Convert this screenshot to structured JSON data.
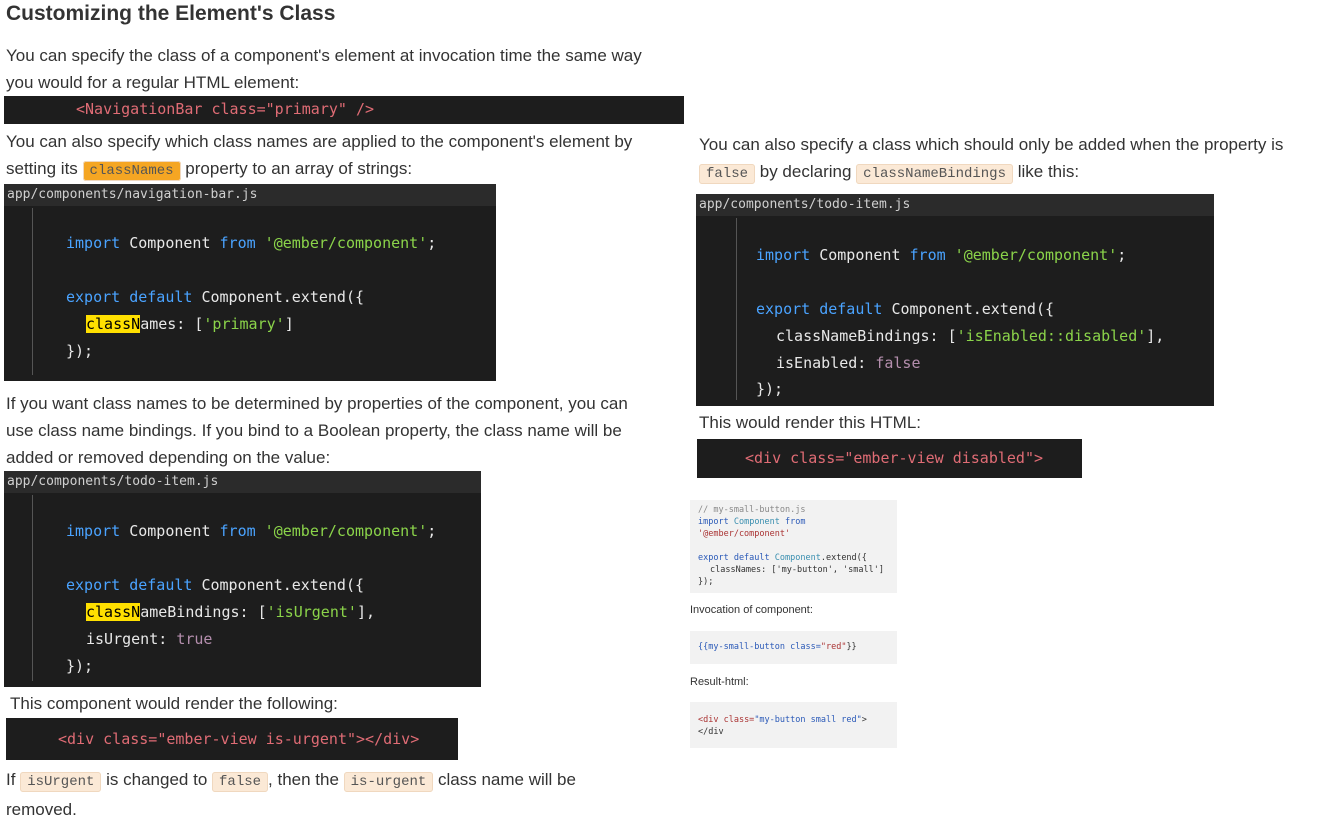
{
  "title": "Customizing the Element's Class",
  "left": {
    "p1_line1": "You can specify the class of a component's element at invocation time the same way",
    "p1_line2": "you would for a regular HTML element:",
    "code1": "<NavigationBar class=\"primary\" />",
    "p2_line1": "You can also specify which class names are applied to the component's element by",
    "p2_before": "setting its",
    "p2_code": "classNames",
    "p2_after": "property to an array of strings:",
    "block1": {
      "filename": "app/components/navigation-bar.js",
      "l1_kw1": "import",
      "l1_mid": " Component ",
      "l1_kw2": "from",
      "l1_str": " '@ember/component'",
      "l1_end": ";",
      "l2_kw": "export default",
      "l2_rest": " Component.extend({",
      "l3_hl": "classN",
      "l3_rest": "ames: [",
      "l3_str": "'primary'",
      "l3_end": "]",
      "l4": "});"
    },
    "p3_line1": "If you want class names to be determined by properties of the component, you can",
    "p3_line2": "use class name bindings. If you bind to a Boolean property, the class name will be",
    "p3_line3": "added or removed depending on the value:",
    "block2": {
      "filename": "app/components/todo-item.js",
      "l1_kw1": "import",
      "l1_mid": " Component ",
      "l1_kw2": "from",
      "l1_str": " '@ember/component'",
      "l1_end": ";",
      "l2_kw": "export default",
      "l2_rest": " Component.extend({",
      "l3_hl": "classN",
      "l3_rest": "ameBindings: [",
      "l3_str": "'isUrgent'",
      "l3_end": "],",
      "l4_prop": "isUrgent: ",
      "l4_bool": "true",
      "l5": "});"
    },
    "p4": "This component would render the following:",
    "code2": "<div class=\"ember-view is-urgent\"></div>",
    "p5_if": "If",
    "p5_code1": "isUrgent",
    "p5_changed": "is changed to",
    "p5_code2": "false",
    "p5_then": ", then the",
    "p5_code3": "is-urgent",
    "p5_end": "class name will be",
    "p5_line2": "removed."
  },
  "right": {
    "p1_line1": "You can also specify a class which should only be added when the property is",
    "p1_code1": "false",
    "p1_by": "by declaring",
    "p1_code2": "classNameBindings",
    "p1_like": "like this:",
    "block": {
      "filename": "app/components/todo-item.js",
      "l1_kw1": "import",
      "l1_mid": " Component ",
      "l1_kw2": "from",
      "l1_str": " '@ember/component'",
      "l1_end": ";",
      "l2_kw": "export default",
      "l2_rest": " Component.extend({",
      "l3_prop": "classNameBindings: [",
      "l3_str": "'isEnabled::disabled'",
      "l3_end": "],",
      "l4_prop": "isEnabled: ",
      "l4_bool": "false",
      "l5": "});"
    },
    "p2": "This would render this HTML:",
    "code": "<div class=\"ember-view disabled\">"
  },
  "small": {
    "code1_l1": "// my-small-button.js",
    "code1_l2_kw": "import",
    "code1_l2_cls": "Component",
    "code1_l2_from": "from",
    "code1_l2_str": "'@ember/component'",
    "code1_l4_kw": "export default",
    "code1_l4_cls": "Component",
    "code1_l4_rest": ".extend({",
    "code1_l5": "classNames: ['my-button', 'small']",
    "code1_l6": "});",
    "label1": "Invocation of component:",
    "code2_a": "{{my-small-button ",
    "code2_b": "class=",
    "code2_c": "\"red\"",
    "code2_d": "}}",
    "label2": "Result-html:",
    "code3_a": "<div ",
    "code3_b": "class=",
    "code3_c": "\"my-button small red\"",
    "code3_d": ">",
    "code3_l2": "</div"
  }
}
